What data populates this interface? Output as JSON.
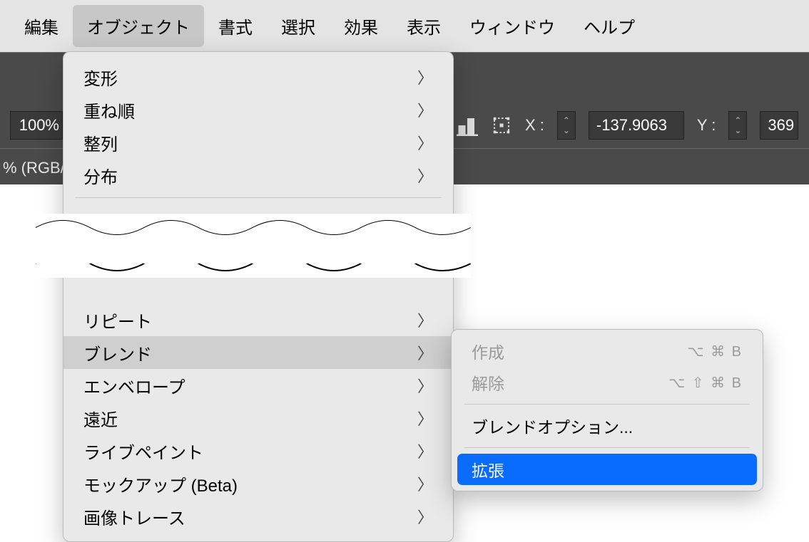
{
  "menubar": {
    "items": [
      "編集",
      "オブジェクト",
      "書式",
      "選択",
      "効果",
      "表示",
      "ウィンドウ",
      "ヘルプ"
    ],
    "active_index": 1
  },
  "control_bar": {
    "zoom": "100%",
    "doc_label": "% (RGB/プ",
    "x_label": "X :",
    "x_value": "-137.9063",
    "y_label": "Y :",
    "y_value": "369"
  },
  "dropdown": {
    "groups": [
      {
        "items": [
          {
            "label": "変形",
            "submenu": true
          },
          {
            "label": "重ね順",
            "submenu": true
          },
          {
            "label": "整列",
            "submenu": true
          },
          {
            "label": "分布",
            "submenu": true
          }
        ]
      },
      {
        "items": [
          {
            "label": "リピート",
            "submenu": true
          },
          {
            "label": "ブレンド",
            "submenu": true,
            "hover": true
          },
          {
            "label": "エンベロープ",
            "submenu": true
          },
          {
            "label": "遠近",
            "submenu": true
          },
          {
            "label": "ライブペイント",
            "submenu": true
          },
          {
            "label": "モックアップ (Beta)",
            "submenu": true
          },
          {
            "label": "画像トレース",
            "submenu": true
          }
        ]
      }
    ]
  },
  "submenu": {
    "groups": [
      {
        "items": [
          {
            "label": "作成",
            "shortcut": "⌥ ⌘ B",
            "disabled": true
          },
          {
            "label": "解除",
            "shortcut": "⌥ ⇧ ⌘ B",
            "disabled": true
          }
        ]
      },
      {
        "items": [
          {
            "label": "ブレンドオプション..."
          }
        ]
      },
      {
        "items": [
          {
            "label": "拡張",
            "selected": true
          }
        ]
      }
    ]
  }
}
